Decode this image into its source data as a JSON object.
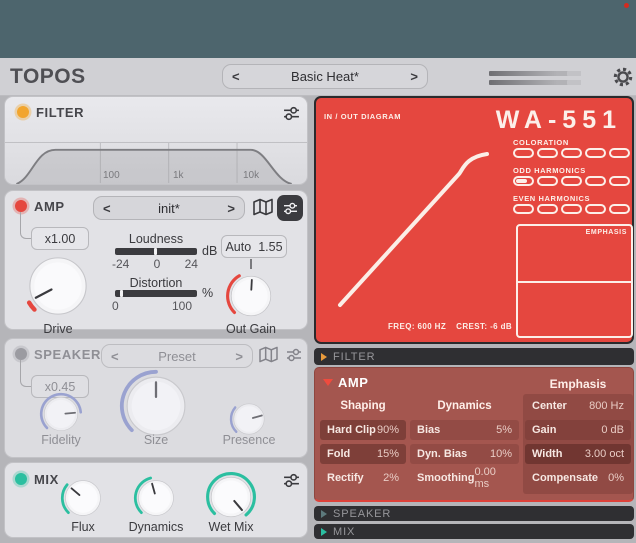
{
  "header": {
    "logo": "TOPOS",
    "preset_browser": {
      "prev": "<",
      "next": ">",
      "value": "Basic Heat*"
    }
  },
  "filter": {
    "title": "FILTER",
    "freq_labels": [
      "100",
      "1k",
      "10k"
    ]
  },
  "amp": {
    "title": "AMP",
    "multiplier": "x1.00",
    "preset": {
      "prev": "<",
      "next": ">",
      "value": "init*"
    },
    "drive_label": "Drive",
    "loudness": {
      "label": "Loudness",
      "unit": "dB",
      "ticks": [
        "-24",
        "0",
        "24"
      ],
      "handle_pos": "48%"
    },
    "distortion": {
      "label": "Distortion",
      "unit": "%",
      "ticks": [
        "0",
        "100"
      ],
      "handle_pos": "6%"
    },
    "auto_label": "Auto",
    "auto_value": "1.55",
    "out_gain_label": "Out Gain"
  },
  "speaker": {
    "title": "SPEAKER",
    "multiplier": "x0.45",
    "preset": {
      "prev": "<",
      "next": ">",
      "value": "Preset"
    },
    "knobs": [
      "Fidelity",
      "Size",
      "Presence"
    ]
  },
  "mix": {
    "title": "MIX",
    "knobs": [
      "Flux",
      "Dynamics",
      "Wet Mix"
    ]
  },
  "display": {
    "diagram_label": "IN / OUT DIAGRAM",
    "model": "WA-551",
    "led_rows": [
      {
        "label": "COLORATION",
        "fills": [
          "0%",
          "0%",
          "0%",
          "0%",
          "0%"
        ]
      },
      {
        "label": "ODD HARMONICS",
        "fills": [
          "62%",
          "0%",
          "0%",
          "0%",
          "0%"
        ]
      },
      {
        "label": "EVEN HARMONICS",
        "fills": [
          "0%",
          "0%",
          "0%",
          "0%",
          "0%"
        ]
      }
    ],
    "emphasis_label": "EMPHASIS",
    "freq_readout": "FREQ: 600 HZ",
    "crest_readout": "CREST: -6 dB"
  },
  "tabs": {
    "filter": "FILTER",
    "speaker": "SPEAKER",
    "mix": "MIX"
  },
  "amp_panel": {
    "title": "AMP",
    "emphasis_header": "Emphasis",
    "shaping_header": "Shaping",
    "dynamics_header": "Dynamics",
    "params": {
      "hard_clip": {
        "name": "Hard Clip",
        "value": "90%"
      },
      "fold": {
        "name": "Fold",
        "value": "15%"
      },
      "rectify": {
        "name": "Rectify",
        "value": "2%"
      },
      "bias": {
        "name": "Bias",
        "value": "5%"
      },
      "dyn_bias": {
        "name": "Dyn. Bias",
        "value": "10%"
      },
      "smoothing": {
        "name": "Smoothing",
        "value": "0.00 ms"
      },
      "center": {
        "name": "Center",
        "value": "800 Hz"
      },
      "gain": {
        "name": "Gain",
        "value": "0 dB"
      },
      "width": {
        "name": "Width",
        "value": "3.00 oct"
      },
      "compensate": {
        "name": "Compensate",
        "value": "0%"
      }
    }
  },
  "colors": {
    "accent_red": "#e5473f",
    "accent_orange": "#f2a52e",
    "accent_teal": "#2bbfa0",
    "accent_blue": "#9aa2d0",
    "display_red": "#e5473f",
    "titlebar": "#4d656d"
  }
}
